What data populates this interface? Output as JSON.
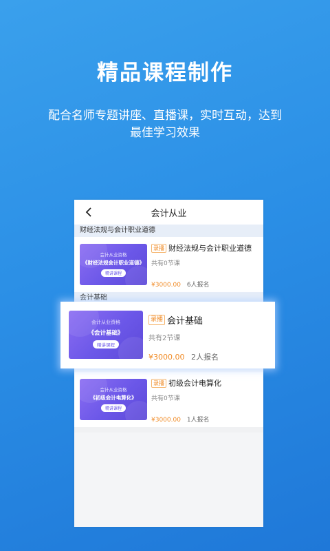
{
  "headline": "精品课程制作",
  "subtitle": "配合名师专题讲座、直播课，实时互动，达到最佳学习效果",
  "screen": {
    "title": "会计从业",
    "back_icon": "chevron-left-icon"
  },
  "sections": [
    {
      "label": "财经法规与会计职业道德",
      "course": {
        "tag": "录播",
        "name": "财经法规与会计职业道德",
        "lessons": "共有0节课",
        "price": "¥3000.00",
        "enrolled": "6人报名",
        "thumb": {
          "line1": "会计从业资格",
          "line2": "《财经法规会计职业道德》",
          "badge": "精讲课程"
        }
      }
    },
    {
      "label": "会计基础",
      "course": {
        "tag": "录播",
        "name": "会计基础",
        "lessons": "共有2节课",
        "price": "¥3000.00",
        "enrolled": "2人报名",
        "thumb": {
          "line1": "会计从业资格",
          "line2": "《会计基础》",
          "badge": "精讲课程"
        }
      }
    },
    {
      "label": "初级会计电算化",
      "course": {
        "tag": "录播",
        "name": "初级会计电算化",
        "lessons": "共有0节课",
        "price": "¥3000.00",
        "enrolled": "1人报名",
        "thumb": {
          "line1": "会计从业资格",
          "line2": "《初级会计电算化》",
          "badge": "精讲课程"
        }
      }
    }
  ],
  "colors": {
    "background": "#2b8fe6",
    "accent_orange": "#f08a24",
    "thumb_purple": "#6b57e8"
  }
}
